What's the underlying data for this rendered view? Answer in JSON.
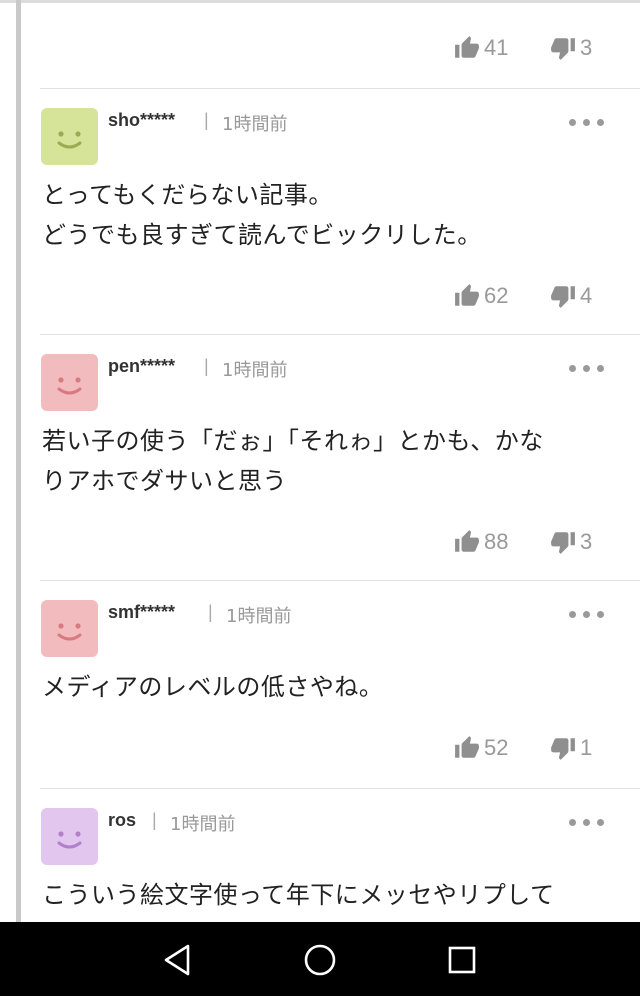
{
  "top_actions": {
    "likes": "41",
    "dislikes": "3"
  },
  "comments": [
    {
      "username": "sho*****",
      "time": "1時間前",
      "avatar_color": "#d6e49a",
      "face_color": "#9bab52",
      "lines": [
        "とってもくだらない記事。",
        "どうでも良すぎて読んでビックリした。"
      ],
      "likes": "62",
      "dislikes": "4"
    },
    {
      "username": "pen*****",
      "time": "1時間前",
      "avatar_color": "#f2bcbf",
      "face_color": "#d97a80",
      "lines": [
        "若い子の使う「だぉ」「それゎ」とかも、かな",
        "りアホでダサいと思う"
      ],
      "likes": "88",
      "dislikes": "3"
    },
    {
      "username": "smf*****",
      "time": "1時間前",
      "avatar_color": "#f2bcbf",
      "face_color": "#d97a80",
      "lines": [
        "メディアのレベルの低さやね。"
      ],
      "likes": "52",
      "dislikes": "1"
    },
    {
      "username": "ros",
      "time": "1時間前",
      "avatar_color": "#e2c6ee",
      "face_color": "#b27fcb",
      "lines": [
        "こういう絵文字使って年下にメッセやリプして"
      ],
      "likes": "",
      "dislikes": ""
    }
  ],
  "nav": {
    "back": "back-icon",
    "home": "home-icon",
    "recents": "recents-icon"
  },
  "colors": {
    "thread_line": "#c9c9c9",
    "icon_gray": "#999999",
    "nav_bg": "#000000"
  }
}
